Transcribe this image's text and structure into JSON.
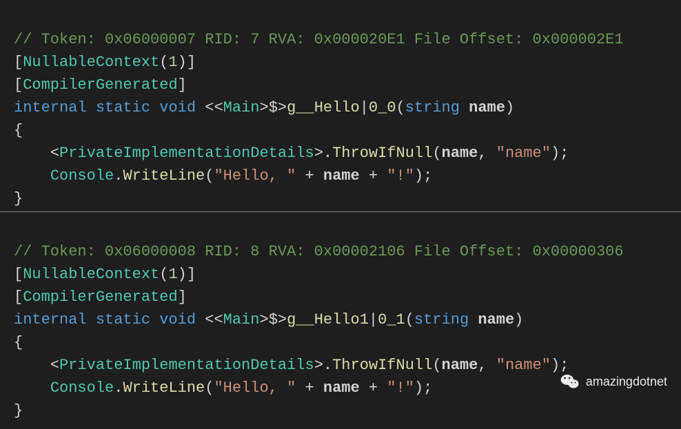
{
  "block1": {
    "comment": "// Token: 0x06000007 RID: 7 RVA: 0x000020E1 File Offset: 0x000002E1",
    "attr1_open": "[",
    "attr1_type": "NullableContext",
    "attr1_l": "(",
    "attr1_num": "1",
    "attr1_r": ")",
    "attr1_close": "]",
    "attr2_open": "[",
    "attr2_type": "CompilerGenerated",
    "attr2_close": "]",
    "kw_internal": "internal",
    "sp1": " ",
    "kw_static": "static",
    "sp2": " ",
    "kw_void": "void",
    "sp3": " ",
    "lt1": "<<",
    "main": "Main",
    "gt1": ">",
    "dollar": "$>",
    "mname": "g__Hello",
    "pipe": "|",
    "idx": "0_0",
    "sig_l": "(",
    "ptype": "string",
    "spp": " ",
    "pname": "name",
    "sig_r": ")",
    "brace_open": "{",
    "indent": "    ",
    "pid_l": "<",
    "pid": "PrivateImplementationDetails",
    "pid_r": ">",
    "dot": ".",
    "throw": "ThrowIfNull",
    "tl": "(",
    "targ1": "name",
    "tcom": ",",
    "tsp": " ",
    "targ2": "\"name\"",
    "tr": ")",
    "tend": ";",
    "console": "Console",
    "cdot": ".",
    "write": "WriteLine",
    "wl": "(",
    "s1": "\"Hello, \"",
    "plus1": " + ",
    "warg": "name",
    "plus2": " + ",
    "s2": "\"!\"",
    "wr": ")",
    "wend": ";",
    "brace_close": "}"
  },
  "block2": {
    "comment": "// Token: 0x06000008 RID: 8 RVA: 0x00002106 File Offset: 0x00000306",
    "attr1_open": "[",
    "attr1_type": "NullableContext",
    "attr1_l": "(",
    "attr1_num": "1",
    "attr1_r": ")",
    "attr1_close": "]",
    "attr2_open": "[",
    "attr2_type": "CompilerGenerated",
    "attr2_close": "]",
    "kw_internal": "internal",
    "sp1": " ",
    "kw_static": "static",
    "sp2": " ",
    "kw_void": "void",
    "sp3": " ",
    "lt1": "<<",
    "main": "Main",
    "gt1": ">",
    "dollar": "$>",
    "mname": "g__Hello1",
    "pipe": "|",
    "idx": "0_1",
    "sig_l": "(",
    "ptype": "string",
    "spp": " ",
    "pname": "name",
    "sig_r": ")",
    "brace_open": "{",
    "indent": "    ",
    "pid_l": "<",
    "pid": "PrivateImplementationDetails",
    "pid_r": ">",
    "dot": ".",
    "throw": "ThrowIfNull",
    "tl": "(",
    "targ1": "name",
    "tcom": ",",
    "tsp": " ",
    "targ2": "\"name\"",
    "tr": ")",
    "tend": ";",
    "console": "Console",
    "cdot": ".",
    "write": "WriteLine",
    "wl": "(",
    "s1": "\"Hello, \"",
    "plus1": " + ",
    "warg": "name",
    "plus2": " + ",
    "s2": "\"!\"",
    "wr": ")",
    "wend": ";",
    "brace_close": "}"
  },
  "watermark": {
    "text": "amazingdotnet"
  }
}
